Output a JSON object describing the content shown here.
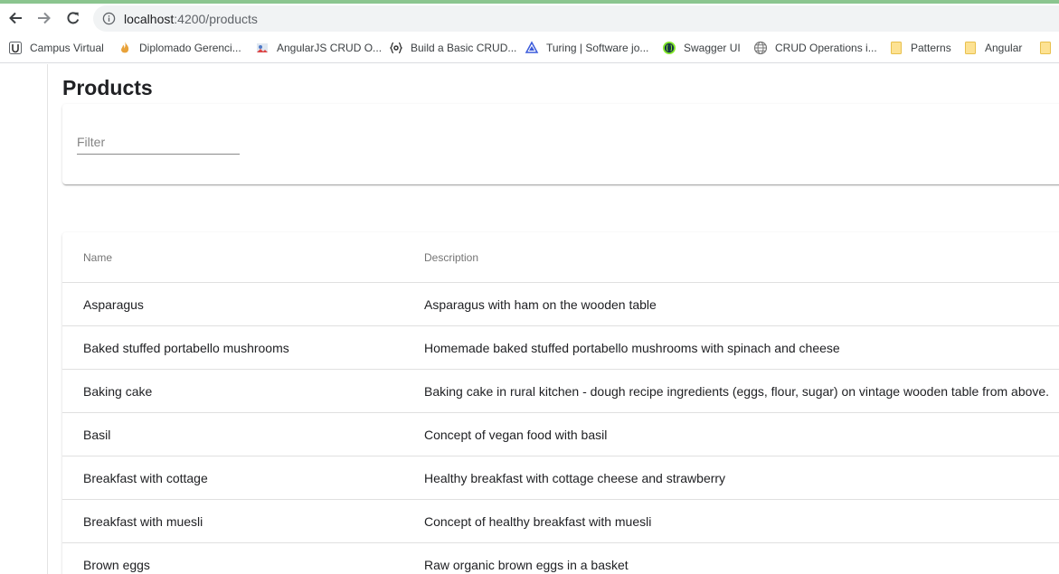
{
  "browser": {
    "accent_color": "#8bc58f",
    "url_host": "localhost",
    "url_path": ":4200/products",
    "bookmarks": [
      {
        "label": "Campus Virtual",
        "icon": "campus-virtual-icon"
      },
      {
        "label": "Diplomado Gerenci...",
        "icon": "flame-icon"
      },
      {
        "label": "AngularJS CRUD O...",
        "icon": "site-icon"
      },
      {
        "label": "Build a Basic CRUD...",
        "icon": "braces-icon"
      },
      {
        "label": "Turing | Software jo...",
        "icon": "turing-icon"
      },
      {
        "label": "Swagger UI",
        "icon": "swagger-icon"
      },
      {
        "label": "CRUD Operations i...",
        "icon": "globe-icon"
      },
      {
        "label": "Patterns",
        "icon": "folder-icon"
      },
      {
        "label": "Angular",
        "icon": "folder-icon"
      }
    ]
  },
  "page": {
    "title": "Products"
  },
  "filter": {
    "placeholder": "Filter",
    "value": ""
  },
  "table": {
    "columns": [
      "Name",
      "Description"
    ],
    "rows": [
      {
        "name": "Asparagus",
        "description": "Asparagus with ham on the wooden table"
      },
      {
        "name": "Baked stuffed portabello mushrooms",
        "description": "Homemade baked stuffed portabello mushrooms with spinach and cheese"
      },
      {
        "name": "Baking cake",
        "description": "Baking cake in rural kitchen - dough recipe ingredients (eggs, flour, sugar) on vintage wooden table from above."
      },
      {
        "name": "Basil",
        "description": "Concept of vegan food with basil"
      },
      {
        "name": "Breakfast with cottage",
        "description": "Healthy breakfast with cottage cheese and strawberry"
      },
      {
        "name": "Breakfast with muesli",
        "description": "Concept of healthy breakfast with muesli"
      },
      {
        "name": "Brown eggs",
        "description": "Raw organic brown eggs in a basket"
      }
    ]
  }
}
